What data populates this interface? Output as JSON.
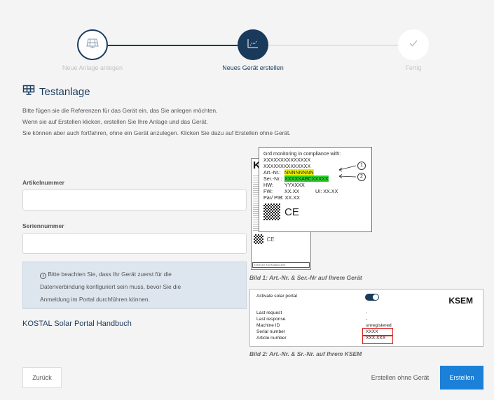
{
  "stepper": {
    "steps": [
      {
        "label": "Neue Anlage anlegen",
        "state": "done"
      },
      {
        "label": "Neues Gerät erstellen",
        "state": "active"
      },
      {
        "label": "Fertig",
        "state": "pending"
      }
    ],
    "icons": [
      "solar-panel-icon",
      "chart-icon",
      "checkmark-icon"
    ]
  },
  "header": {
    "icon": "solar-panel-icon",
    "title": "Testanlage"
  },
  "intro": {
    "lines": [
      "Bitte fügen sie die Referenzen für das Gerät ein, das Sie anlegen möchten.",
      "Wenn sie auf Erstellen klicken, erstellen Sie Ihre Anlage und das Gerät.",
      "Sie können aber auch fortfahren, ohne ein Gerät anzulegen. Klicken Sie dazu auf Erstellen ohne Gerät."
    ]
  },
  "form": {
    "article_label": "Artikelnummer",
    "article_value": "",
    "serial_label": "Seriennummer",
    "serial_value": ""
  },
  "notice": {
    "icon": "info-icon",
    "text_line1": "Bitte beachten Sie, dass Ihr Gerät zuerst für die",
    "text_line2": "Datenverbindung konfiguriert sein muss, bevor Sie die",
    "text_line3": "Anmeldung im Portal durchführen können."
  },
  "handbook_link": "KOSTAL Solar Portal Handbuch",
  "label_image": {
    "header": "Grd monitoring in compliance with:",
    "line_x1": "XXXXXXXXXXXXXX",
    "line_x2": "XXXXXXXXXXXXXX",
    "art_label": "Art.-Nr.:",
    "art_value": "NNNNNNNN",
    "ser_label": "Ser.-Nr.:",
    "ser_value": "XXXXXABCXXXXX",
    "hw_label": "HW:",
    "hw_value": "YYXXXX",
    "fw_label": "FW:",
    "fw_value": "XX.XX",
    "ui_label": "UI:",
    "ui_value": "XX.XX",
    "par_label": "Par/ PIB:",
    "par_value": "XX.XX",
    "marker1": "1",
    "marker2": "2",
    "ce": "CE",
    "back_logo": "KO",
    "back_bottom": "XXXXXXX XXXXXABCXXXX",
    "caption": "Bild 1: Art.-Nr. & Ser.-Nr auf Ihrem Gerät"
  },
  "ksem_image": {
    "activate_label": "Activate solar portal",
    "brand": "KSEM",
    "rows": [
      {
        "label": "Last request",
        "value": "-"
      },
      {
        "label": "Last response",
        "value": "-"
      },
      {
        "label": "Machine ID",
        "value": "unregistered"
      },
      {
        "label": "Serial number",
        "value": "XXXX"
      },
      {
        "label": "Article number",
        "value": "XXX.XXX"
      }
    ],
    "caption": "Bild 2: Art.-Nr. & Sr.-Nr. auf Ihrem KSEM"
  },
  "footer": {
    "back_label": "Zurück",
    "without_device_label": "Erstellen ohne Gerät",
    "create_label": "Erstellen"
  },
  "colors": {
    "navy": "#1a3a5c",
    "primary_button": "#1b80d8",
    "notice_bg": "#dde5ee"
  }
}
